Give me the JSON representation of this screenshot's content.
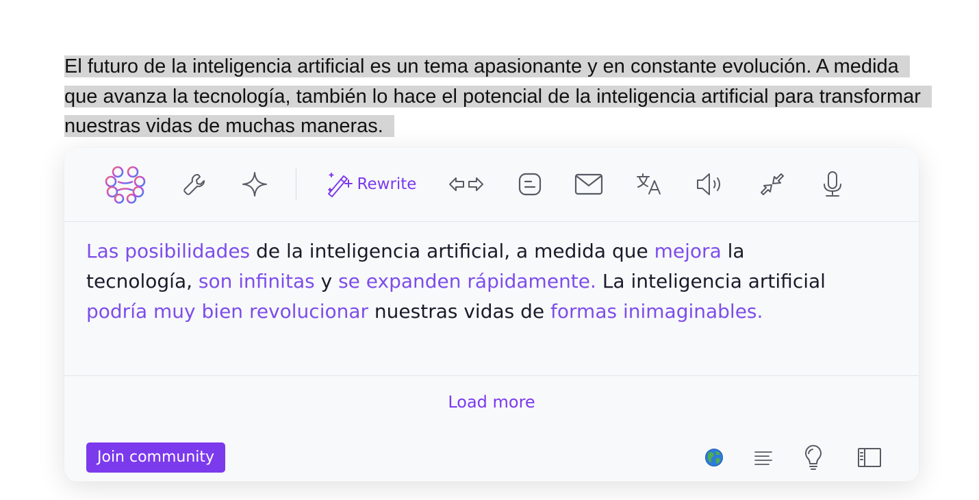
{
  "selection": {
    "text": "El futuro de la inteligencia artificial es un tema apasionante y en constante evolución. A medida que avanza la tecnología, también lo hace el potencial de la inteligencia artificial para transformar nuestras vidas de muchas maneras."
  },
  "toolbar": {
    "items": [
      {
        "icon": "brain-logo-icon"
      },
      {
        "icon": "wrench-icon"
      },
      {
        "icon": "sparkle-icon"
      },
      {
        "icon": "magic-wand-icon",
        "label": "Rewrite"
      },
      {
        "icon": "arrows-left-right-icon"
      },
      {
        "icon": "blogger-icon"
      },
      {
        "icon": "mail-icon"
      },
      {
        "icon": "translate-icon"
      },
      {
        "icon": "speaker-icon"
      },
      {
        "icon": "shrink-arrows-icon"
      },
      {
        "icon": "microphone-icon"
      }
    ]
  },
  "result": {
    "segments": [
      {
        "text": "Las posibilidades",
        "highlight": true
      },
      {
        "text": " de la inteligencia artificial, a medida que ",
        "highlight": false
      },
      {
        "text": "mejora",
        "highlight": true
      },
      {
        "text": " la tecnología, ",
        "highlight": false
      },
      {
        "text": "son infinitas",
        "highlight": true
      },
      {
        "text": " y ",
        "highlight": false
      },
      {
        "text": "se expanden rápidamente.",
        "highlight": true
      },
      {
        "text": " La inteligencia artificial ",
        "highlight": false
      },
      {
        "text": "podría muy bien revolucionar",
        "highlight": true
      },
      {
        "text": " nuestras vidas de ",
        "highlight": false
      },
      {
        "text": "formas inimaginables.",
        "highlight": true
      }
    ]
  },
  "footer": {
    "load_more": "Load more",
    "join_community": "Join community",
    "icons": [
      "globe-icon",
      "align-text-icon",
      "lightbulb-icon",
      "sidebar-panel-icon"
    ]
  },
  "colors": {
    "accent": "#7c3aed",
    "highlight_text": "#7c4dea",
    "selection_bg": "#d5d5d5"
  }
}
